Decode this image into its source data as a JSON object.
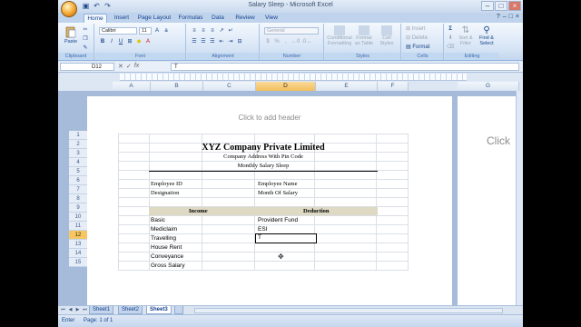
{
  "window": {
    "title": "Salary Sleep - Microsoft Excel",
    "controls": [
      "–",
      "□",
      "×"
    ]
  },
  "quick_access": [
    "save-icon",
    "undo-icon",
    "redo-icon"
  ],
  "ribbon": {
    "tabs": [
      "Home",
      "Insert",
      "Page Layout",
      "Formulas",
      "Data",
      "Review",
      "View"
    ],
    "active_tab": "Home",
    "groups": {
      "clipboard": {
        "label": "Clipboard",
        "paste": "Paste"
      },
      "font": {
        "label": "Font",
        "family": "Calibri",
        "size": "11",
        "bold": "B",
        "italic": "I",
        "underline": "U"
      },
      "alignment": {
        "label": "Alignment"
      },
      "number": {
        "label": "Number",
        "format": "General",
        "currency": "$",
        "percent": "%",
        "comma": ","
      },
      "styles": {
        "label": "Styles",
        "conditional": "Conditional Formatting",
        "format_table": "Format as Table",
        "cell_styles": "Cell Styles"
      },
      "cells": {
        "label": "Cells",
        "insert": "Insert",
        "delete": "Delete",
        "format": "Format"
      },
      "editing": {
        "label": "Editing",
        "sigma": "Σ",
        "sort": "Sort & Filter",
        "find": "Find & Select"
      }
    }
  },
  "formula_bar": {
    "name_box": "D12",
    "content": "T"
  },
  "columns": [
    "A",
    "B",
    "C",
    "D",
    "E",
    "F",
    "G"
  ],
  "selected_column": "D",
  "rows": [
    "1",
    "2",
    "3",
    "4",
    "5",
    "6",
    "7",
    "8",
    "9",
    "10",
    "11",
    "12",
    "13",
    "14",
    "15"
  ],
  "selected_row": "12",
  "page": {
    "header_hint": "Click to add header",
    "next_page_hint": "Click"
  },
  "sheet": {
    "company_name": "XYZ Company Private Limited",
    "address": "Company Address With Pin Code",
    "subtitle": "Monthly Salary Sleep",
    "employee_id": "Employee ID",
    "designation": "Designation",
    "employee_name": "Employee Name",
    "month_of_salary": "Month Of Salary",
    "income_header": "Income",
    "deduction_header": "Deduction",
    "income_items": [
      "Basic",
      "Mediclaim",
      "Travelling",
      "House Rent",
      "Conveyance",
      "Gross Salary"
    ],
    "deduction_items": [
      "Provident Fund",
      "ESI"
    ],
    "active_cell_value": "T"
  },
  "sheet_tabs": [
    "Sheet1",
    "Sheet2",
    "Sheet3"
  ],
  "active_sheet": "Sheet3",
  "status": {
    "mode": "Enter",
    "page": "Page: 1 of 1"
  }
}
